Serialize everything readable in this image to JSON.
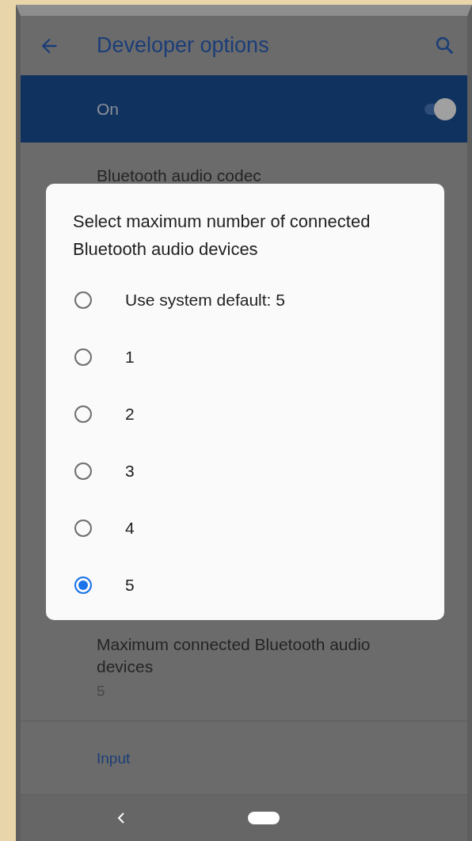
{
  "app_bar": {
    "title": "Developer options"
  },
  "master_switch": {
    "label": "On",
    "on": true
  },
  "settings": [
    {
      "kind": "item",
      "title": "Bluetooth audio codec"
    },
    {
      "kind": "item",
      "title": "Maximum connected Bluetooth audio devices",
      "summary": "5"
    },
    {
      "kind": "header",
      "title": "Input"
    }
  ],
  "dialog": {
    "title": "Select maximum number of connected Bluetooth audio devices",
    "options": [
      {
        "label": "Use system default: 5",
        "selected": false
      },
      {
        "label": "1",
        "selected": false
      },
      {
        "label": "2",
        "selected": false
      },
      {
        "label": "3",
        "selected": false
      },
      {
        "label": "4",
        "selected": false
      },
      {
        "label": "5",
        "selected": true
      }
    ]
  }
}
